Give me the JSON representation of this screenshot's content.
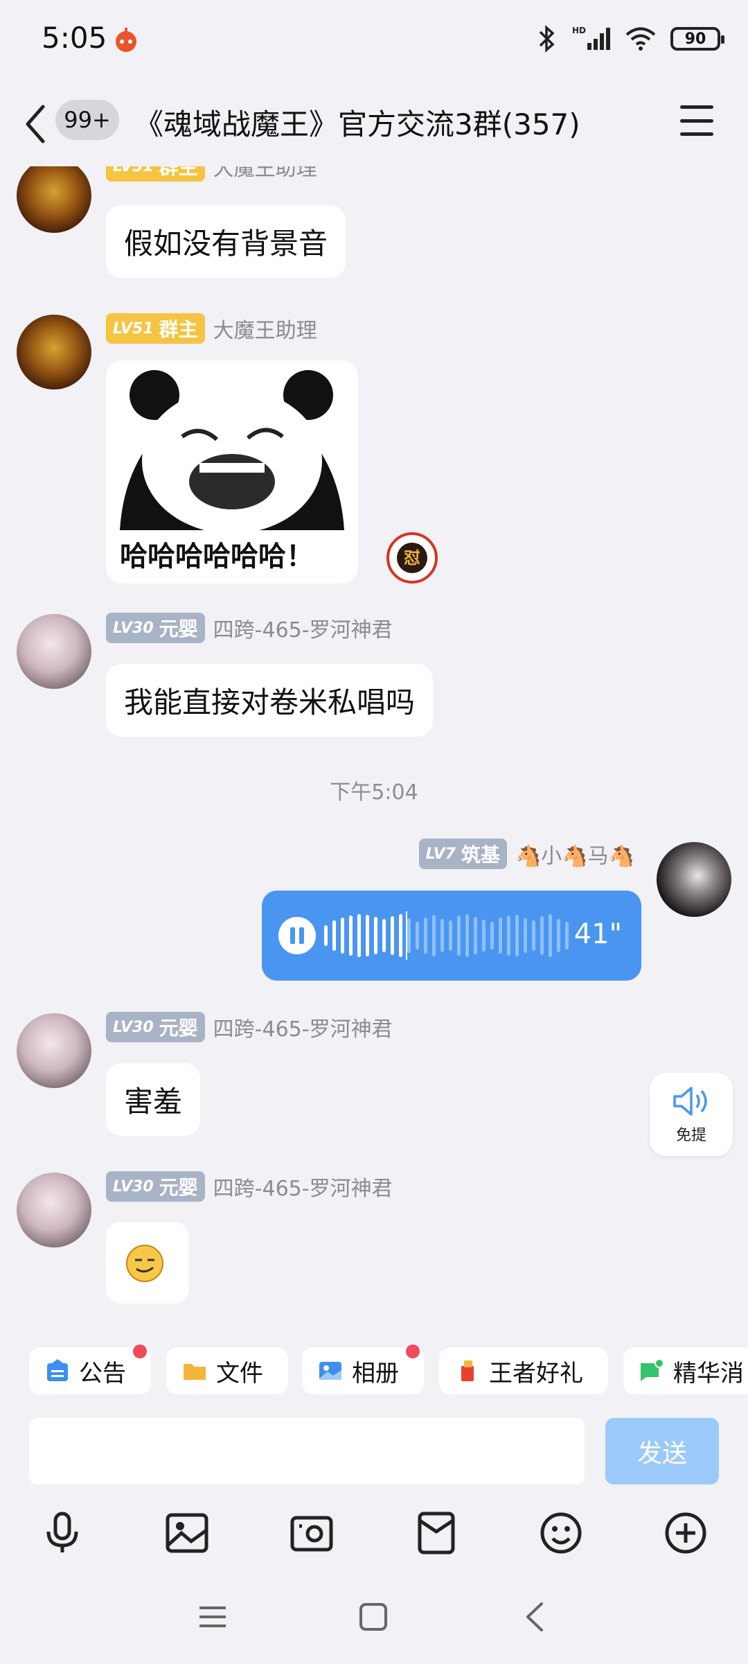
{
  "status": {
    "time": "5:05",
    "battery": "90",
    "network": "HD"
  },
  "header": {
    "unread_badge": "99+",
    "title": "《魂域战魔王》官方交流3群(357)"
  },
  "messages": [
    {
      "level": "LV51",
      "role": "群主",
      "nick": "大魔王助理",
      "text": "假如没有背景音"
    },
    {
      "level": "LV51",
      "role": "群主",
      "nick": "大魔王助理",
      "sticker_text": "哈哈哈哈哈哈！"
    },
    {
      "level": "LV30",
      "role": "元婴",
      "nick": "四跨-465-罗河神君",
      "text": "我能直接对卷米私唱吗"
    },
    {
      "time_separator": "下午5:04"
    },
    {
      "level": "LV7",
      "role": "筑基",
      "nick": "🐴小🐴马🐴",
      "voice_duration": "41\""
    },
    {
      "level": "LV30",
      "role": "元婴",
      "nick": "四跨-465-罗河神君",
      "text": "害羞"
    },
    {
      "level": "LV30",
      "role": "元婴",
      "nick": "四跨-465-罗河神君",
      "emoji": "smirk-emoji"
    }
  ],
  "handsfree": {
    "label": "免提"
  },
  "quick_tabs": [
    {
      "label": "公告",
      "icon": "announcement-icon",
      "dot": true
    },
    {
      "label": "文件",
      "icon": "folder-icon",
      "dot": false
    },
    {
      "label": "相册",
      "icon": "album-icon",
      "dot": true
    },
    {
      "label": "王者好礼",
      "icon": "gift-icon",
      "dot": false
    },
    {
      "label": "精华消",
      "icon": "essence-icon",
      "dot": false
    }
  ],
  "composer": {
    "placeholder": "",
    "send_label": "发送"
  },
  "toolbar": [
    "microphone-icon",
    "image-icon",
    "camera-icon",
    "red-packet-icon",
    "emoji-icon",
    "plus-icon"
  ],
  "colors": {
    "accent": "#4a95f0",
    "gold_badge": "#f6c443",
    "gray_badge": "#a9b3c6",
    "send_disabled": "#9ccaf8"
  }
}
